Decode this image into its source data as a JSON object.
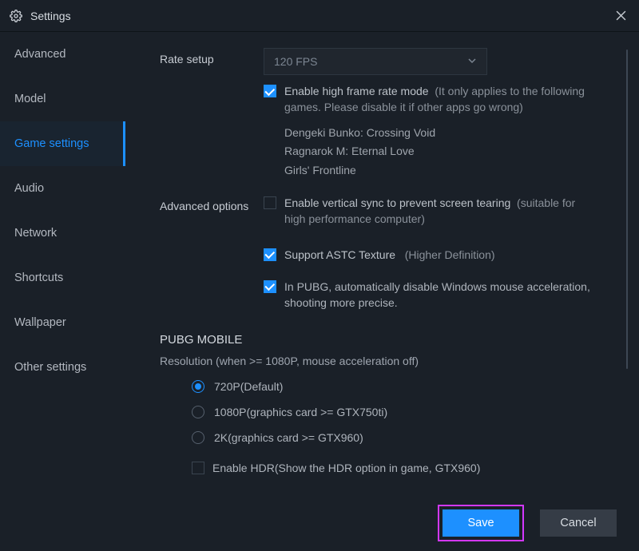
{
  "window": {
    "title": "Settings"
  },
  "sidebar": {
    "items": [
      {
        "label": "Advanced"
      },
      {
        "label": "Model"
      },
      {
        "label": "Game settings"
      },
      {
        "label": "Audio"
      },
      {
        "label": "Network"
      },
      {
        "label": "Shortcuts"
      },
      {
        "label": "Wallpaper"
      },
      {
        "label": "Other settings"
      }
    ],
    "active_index": 2
  },
  "rate": {
    "label": "Rate setup",
    "selected": "120 FPS",
    "hfr": {
      "checked": true,
      "text": "Enable high frame rate mode",
      "hint": "(It only applies to the following games. Please disable it if other apps go wrong)",
      "games": [
        "Dengeki Bunko: Crossing Void",
        "Ragnarok M: Eternal Love",
        "Girls' Frontline"
      ]
    }
  },
  "advanced": {
    "label": "Advanced options",
    "vsync": {
      "checked": false,
      "text": "Enable vertical sync to prevent screen tearing",
      "hint": "(suitable for high performance computer)"
    },
    "astc": {
      "checked": true,
      "text": "Support ASTC Texture",
      "hint": "(Higher Definition)"
    },
    "pubg_mouse": {
      "checked": true,
      "text": "In PUBG, automatically disable Windows mouse acceleration, shooting more precise."
    }
  },
  "pubg": {
    "title": "PUBG MOBILE",
    "res_label": "Resolution (when >= 1080P, mouse acceleration off)",
    "options": [
      "720P(Default)",
      "1080P(graphics card >= GTX750ti)",
      "2K(graphics card >= GTX960)"
    ],
    "selected_index": 0,
    "hdr": {
      "checked": false,
      "text": "Enable HDR(Show the HDR option in game, GTX960)"
    }
  },
  "footer": {
    "save": "Save",
    "cancel": "Cancel"
  }
}
